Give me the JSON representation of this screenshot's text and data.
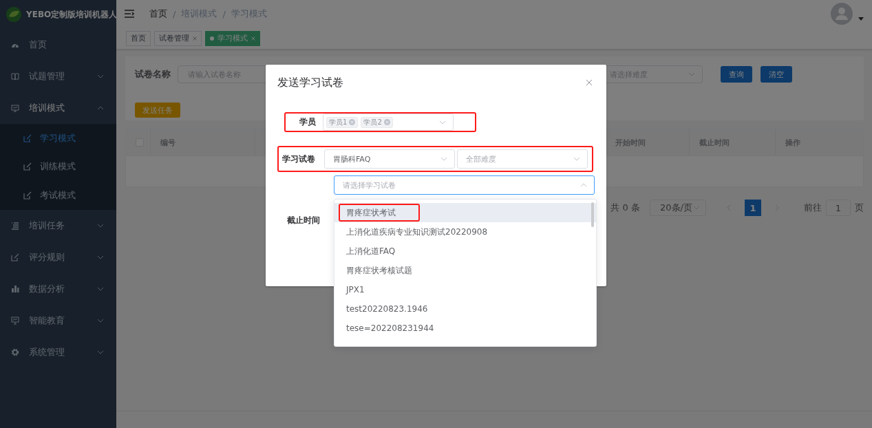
{
  "sidebar": {
    "logo_text": "YEBO定制版培训机器人",
    "items": [
      {
        "label": "首页",
        "expandable": false,
        "expanded": false
      },
      {
        "label": "试题管理",
        "expandable": true,
        "expanded": false
      },
      {
        "label": "培训模式",
        "expandable": true,
        "expanded": true,
        "children": [
          {
            "label": "学习模式",
            "selected": true
          },
          {
            "label": "训练模式",
            "selected": false
          },
          {
            "label": "考试模式",
            "selected": false
          }
        ]
      },
      {
        "label": "培训任务",
        "expandable": true,
        "expanded": false
      },
      {
        "label": "评分规则",
        "expandable": true,
        "expanded": false
      },
      {
        "label": "数据分析",
        "expandable": true,
        "expanded": false
      },
      {
        "label": "智能教育",
        "expandable": true,
        "expanded": false
      },
      {
        "label": "系统管理",
        "expandable": true,
        "expanded": false
      }
    ]
  },
  "header": {
    "breadcrumb_separator": "/",
    "breadcrumb": [
      {
        "label": "首页",
        "link": true
      },
      {
        "label": "培训模式",
        "link": false
      },
      {
        "label": "学习模式",
        "link": false
      }
    ]
  },
  "tags": [
    {
      "label": "首页",
      "closable": false,
      "selected": false
    },
    {
      "label": "试卷管理",
      "closable": true,
      "selected": false
    },
    {
      "label": "学习模式",
      "closable": true,
      "selected": true
    }
  ],
  "filter": {
    "fields": [
      {
        "kind": "input",
        "label": "试卷名称",
        "placeholder": "请输入试卷名称"
      },
      {
        "kind": "select",
        "placeholder": "请选择难度"
      }
    ],
    "buttons": [
      "查询",
      "清空"
    ],
    "action_button": "发送任务"
  },
  "table": {
    "select_all_checked": false,
    "columns": [
      "编号",
      "",
      "开始时间",
      "截止时间",
      "操作"
    ]
  },
  "pagination": {
    "total": "共 0 条",
    "page_size": "20条/页",
    "pages": [
      {
        "label": "1",
        "selected": true
      }
    ],
    "goto_label": "前往",
    "goto_value": "1",
    "page_suffix": "页"
  },
  "dialog": {
    "title": "发送学习试卷",
    "fields": [
      {
        "kind": "tags",
        "label": "学员",
        "tags": [
          "学员1",
          "学员2"
        ],
        "annotated": true
      },
      {
        "kind": "select_pair",
        "label": "学习试卷",
        "value": "胃肠科FAQ",
        "placeholder": "全部难度",
        "annotated": true
      },
      {
        "kind": "select",
        "placeholder": "请选择学习试卷",
        "expanded": true,
        "options": [
          {
            "label": "胃疼症状考试",
            "hovered": true,
            "annotated": true
          },
          {
            "label": "上消化道疾病专业知识测试20220908",
            "hovered": false,
            "annotated": false
          },
          {
            "label": "上消化道FAQ",
            "hovered": false,
            "annotated": false
          },
          {
            "label": "胃疼症状考核试题",
            "hovered": false,
            "annotated": false
          },
          {
            "label": "JPX1",
            "hovered": false,
            "annotated": false
          },
          {
            "label": "test20220823.1946",
            "hovered": false,
            "annotated": false
          },
          {
            "label": "tese=202208231944",
            "hovered": false,
            "annotated": false
          }
        ]
      },
      {
        "kind": "label_only",
        "label": "截止时间"
      }
    ]
  }
}
